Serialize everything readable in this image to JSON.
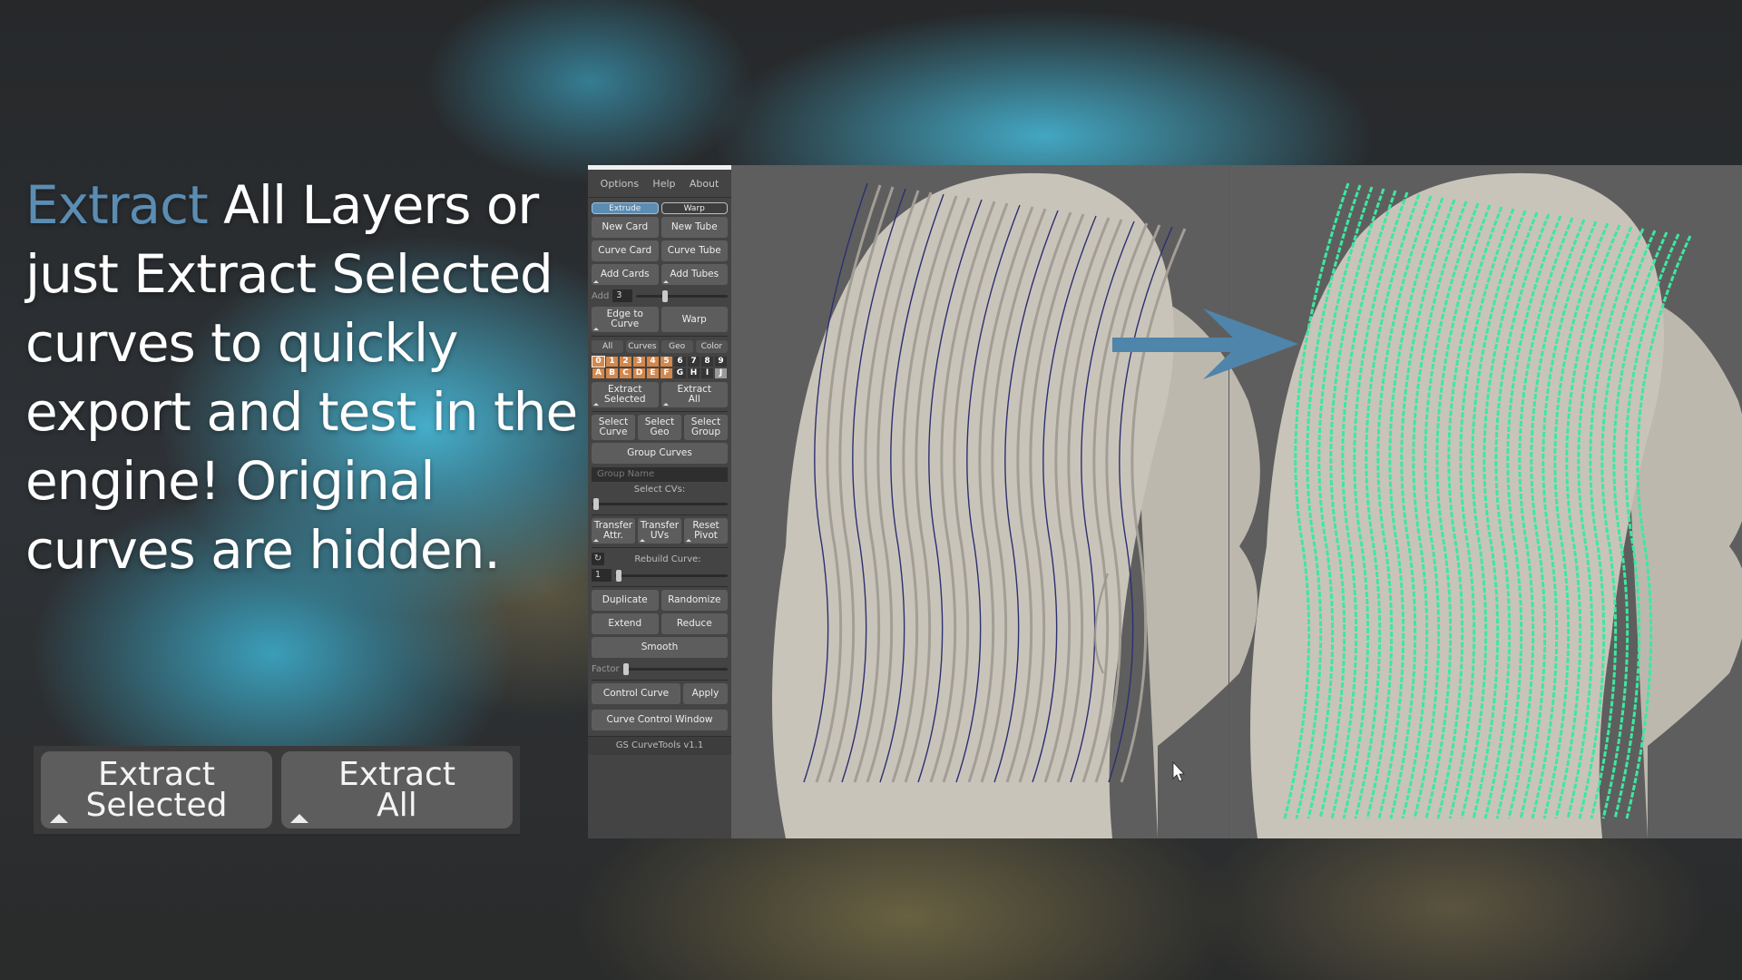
{
  "caption": {
    "accent_word": "Extract",
    "rest": " All Layers or just Extract Selected curves to quickly export and test in the engine! Original curves are hidden.",
    "accent_color": "#5b8db3"
  },
  "big_buttons": [
    {
      "line1": "Extract",
      "line2": "Selected"
    },
    {
      "line1": "Extract",
      "line2": "All"
    }
  ],
  "panel": {
    "menu": [
      "Options",
      "Help",
      "About"
    ],
    "mode_toggle": {
      "extrude": "Extrude",
      "warp": "Warp",
      "active": "Extrude"
    },
    "new_card": "New Card",
    "new_tube": "New Tube",
    "curve_card": "Curve Card",
    "curve_tube": "Curve Tube",
    "add_cards": "Add Cards",
    "add_tubes": "Add Tubes",
    "add_label": "Add",
    "add_value": "3",
    "add_slider_fraction": 0.3,
    "edge_to_curve": {
      "line1": "Edge to",
      "line2": "Curve"
    },
    "warp": "Warp",
    "filter_tabs": [
      "All",
      "Curves",
      "Geo",
      "Color"
    ],
    "layers_row1": [
      "0",
      "1",
      "2",
      "3",
      "4",
      "5",
      "6",
      "7",
      "8",
      "9"
    ],
    "layers_row2": [
      "A",
      "B",
      "C",
      "D",
      "E",
      "F",
      "G",
      "H",
      "I",
      "J"
    ],
    "active_layer_count_per_row": 6,
    "selected_layer": "0",
    "extract_selected": {
      "line1": "Extract",
      "line2": "Selected"
    },
    "extract_all": {
      "line1": "Extract",
      "line2": "All"
    },
    "select_curve": {
      "line1": "Select",
      "line2": "Curve"
    },
    "select_geo": {
      "line1": "Select",
      "line2": "Geo"
    },
    "select_group": {
      "line1": "Select",
      "line2": "Group"
    },
    "group_curves": "Group Curves",
    "group_name_placeholder": "Group Name",
    "select_cvs_label": "Select CVs:",
    "select_cvs_fraction": 0.0,
    "transfer_attr": {
      "line1": "Transfer",
      "line2": "Attr."
    },
    "transfer_uvs": {
      "line1": "Transfer",
      "line2": "UVs"
    },
    "reset_pivot": {
      "line1": "Reset",
      "line2": "Pivot"
    },
    "rebuild_curve_label": "Rebuild Curve:",
    "rebuild_value": "1",
    "rebuild_fraction": 0.0,
    "duplicate": "Duplicate",
    "randomize": "Randomize",
    "extend": "Extend",
    "reduce": "Reduce",
    "smooth": "Smooth",
    "factor_label": "Factor",
    "factor_fraction": 0.0,
    "control_curve": "Control Curve",
    "apply": "Apply",
    "curve_control_window": "Curve Control Window",
    "version": "GS CurveTools v1.1"
  },
  "viewport": {
    "arrow_color": "#4f84ab",
    "wire_color": "#3de8a0",
    "mesh_color": "#c7c2b8"
  }
}
